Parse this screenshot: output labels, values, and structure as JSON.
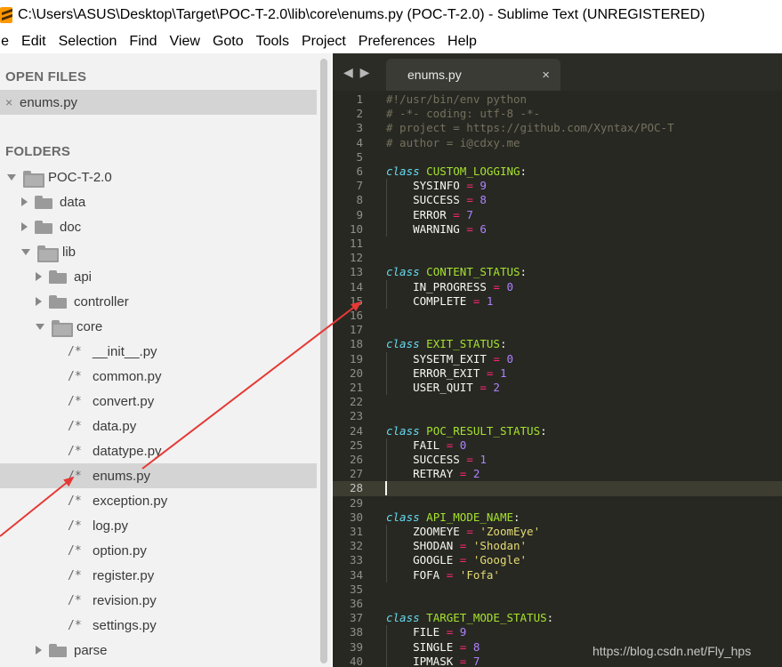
{
  "window": {
    "title": "C:\\Users\\ASUS\\Desktop\\Target\\POC-T-2.0\\lib\\core\\enums.py (POC-T-2.0) - Sublime Text (UNREGISTERED)"
  },
  "menu": [
    "ile",
    "Edit",
    "Selection",
    "Find",
    "View",
    "Goto",
    "Tools",
    "Project",
    "Preferences",
    "Help"
  ],
  "sidebar": {
    "open_files_heading": "OPEN FILES",
    "open_files": [
      {
        "label": "enums.py",
        "close": "×"
      }
    ],
    "folders_heading": "FOLDERS",
    "tree": [
      {
        "label": "POC-T-2.0",
        "kind": "folder",
        "expanded": true
      },
      {
        "label": "data",
        "kind": "folder",
        "expanded": false
      },
      {
        "label": "doc",
        "kind": "folder",
        "expanded": false
      },
      {
        "label": "lib",
        "kind": "folder",
        "expanded": true
      },
      {
        "label": "api",
        "kind": "folder",
        "expanded": false
      },
      {
        "label": "controller",
        "kind": "folder",
        "expanded": false
      },
      {
        "label": "core",
        "kind": "folder",
        "expanded": true
      },
      {
        "label": "__init__.py",
        "kind": "file"
      },
      {
        "label": "common.py",
        "kind": "file"
      },
      {
        "label": "convert.py",
        "kind": "file"
      },
      {
        "label": "data.py",
        "kind": "file"
      },
      {
        "label": "datatype.py",
        "kind": "file"
      },
      {
        "label": "enums.py",
        "kind": "file",
        "selected": true
      },
      {
        "label": "exception.py",
        "kind": "file"
      },
      {
        "label": "log.py",
        "kind": "file"
      },
      {
        "label": "option.py",
        "kind": "file"
      },
      {
        "label": "register.py",
        "kind": "file"
      },
      {
        "label": "revision.py",
        "kind": "file"
      },
      {
        "label": "settings.py",
        "kind": "file"
      },
      {
        "label": "parse",
        "kind": "folder",
        "expanded": false
      }
    ],
    "file_glyph": "/*"
  },
  "editor": {
    "tab_nav": "◀ ▶",
    "tab": {
      "label": "enums.py",
      "close": "×"
    },
    "current_line": 28,
    "lines": [
      {
        "n": "1",
        "t": [
          [
            "c-comment",
            "#!/usr/bin/env python"
          ]
        ]
      },
      {
        "n": "2",
        "t": [
          [
            "c-comment",
            "# -*- coding: utf-8 -*-"
          ]
        ]
      },
      {
        "n": "3",
        "t": [
          [
            "c-comment",
            "# project = https://github.com/Xyntax/POC-T"
          ]
        ]
      },
      {
        "n": "4",
        "t": [
          [
            "c-comment",
            "# author = i@cdxy.me"
          ]
        ]
      },
      {
        "n": "5",
        "t": []
      },
      {
        "n": "6",
        "t": [
          [
            "c-kw",
            "class"
          ],
          [
            "c-plain",
            " "
          ],
          [
            "c-cls",
            "CUSTOM_LOGGING"
          ],
          [
            "c-plain",
            ":"
          ]
        ]
      },
      {
        "n": "7",
        "t": [
          [
            "c-plain",
            "    SYSINFO "
          ],
          [
            "c-op",
            "="
          ],
          [
            "c-plain",
            " "
          ],
          [
            "c-num",
            "9"
          ]
        ]
      },
      {
        "n": "8",
        "t": [
          [
            "c-plain",
            "    SUCCESS "
          ],
          [
            "c-op",
            "="
          ],
          [
            "c-plain",
            " "
          ],
          [
            "c-num",
            "8"
          ]
        ]
      },
      {
        "n": "9",
        "t": [
          [
            "c-plain",
            "    ERROR "
          ],
          [
            "c-op",
            "="
          ],
          [
            "c-plain",
            " "
          ],
          [
            "c-num",
            "7"
          ]
        ]
      },
      {
        "n": "10",
        "t": [
          [
            "c-plain",
            "    WARNING "
          ],
          [
            "c-op",
            "="
          ],
          [
            "c-plain",
            " "
          ],
          [
            "c-num",
            "6"
          ]
        ]
      },
      {
        "n": "11",
        "t": []
      },
      {
        "n": "12",
        "t": []
      },
      {
        "n": "13",
        "t": [
          [
            "c-kw",
            "class"
          ],
          [
            "c-plain",
            " "
          ],
          [
            "c-cls",
            "CONTENT_STATUS"
          ],
          [
            "c-plain",
            ":"
          ]
        ]
      },
      {
        "n": "14",
        "t": [
          [
            "c-plain",
            "    IN_PROGRESS "
          ],
          [
            "c-op",
            "="
          ],
          [
            "c-plain",
            " "
          ],
          [
            "c-num",
            "0"
          ]
        ]
      },
      {
        "n": "15",
        "t": [
          [
            "c-plain",
            "    COMPLETE "
          ],
          [
            "c-op",
            "="
          ],
          [
            "c-plain",
            " "
          ],
          [
            "c-num",
            "1"
          ]
        ]
      },
      {
        "n": "16",
        "t": []
      },
      {
        "n": "17",
        "t": []
      },
      {
        "n": "18",
        "t": [
          [
            "c-kw",
            "class"
          ],
          [
            "c-plain",
            " "
          ],
          [
            "c-cls",
            "EXIT_STATUS"
          ],
          [
            "c-plain",
            ":"
          ]
        ]
      },
      {
        "n": "19",
        "t": [
          [
            "c-plain",
            "    SYSETM_EXIT "
          ],
          [
            "c-op",
            "="
          ],
          [
            "c-plain",
            " "
          ],
          [
            "c-num",
            "0"
          ]
        ]
      },
      {
        "n": "20",
        "t": [
          [
            "c-plain",
            "    ERROR_EXIT "
          ],
          [
            "c-op",
            "="
          ],
          [
            "c-plain",
            " "
          ],
          [
            "c-num",
            "1"
          ]
        ]
      },
      {
        "n": "21",
        "t": [
          [
            "c-plain",
            "    USER_QUIT "
          ],
          [
            "c-op",
            "="
          ],
          [
            "c-plain",
            " "
          ],
          [
            "c-num",
            "2"
          ]
        ]
      },
      {
        "n": "22",
        "t": []
      },
      {
        "n": "23",
        "t": []
      },
      {
        "n": "24",
        "t": [
          [
            "c-kw",
            "class"
          ],
          [
            "c-plain",
            " "
          ],
          [
            "c-cls",
            "POC_RESULT_STATUS"
          ],
          [
            "c-plain",
            ":"
          ]
        ]
      },
      {
        "n": "25",
        "t": [
          [
            "c-plain",
            "    FAIL "
          ],
          [
            "c-op",
            "="
          ],
          [
            "c-plain",
            " "
          ],
          [
            "c-num",
            "0"
          ]
        ]
      },
      {
        "n": "26",
        "t": [
          [
            "c-plain",
            "    SUCCESS "
          ],
          [
            "c-op",
            "="
          ],
          [
            "c-plain",
            " "
          ],
          [
            "c-num",
            "1"
          ]
        ]
      },
      {
        "n": "27",
        "t": [
          [
            "c-plain",
            "    RETRAY "
          ],
          [
            "c-op",
            "="
          ],
          [
            "c-plain",
            " "
          ],
          [
            "c-num",
            "2"
          ]
        ]
      },
      {
        "n": "28",
        "t": []
      },
      {
        "n": "29",
        "t": []
      },
      {
        "n": "30",
        "t": [
          [
            "c-kw",
            "class"
          ],
          [
            "c-plain",
            " "
          ],
          [
            "c-cls",
            "API_MODE_NAME"
          ],
          [
            "c-plain",
            ":"
          ]
        ]
      },
      {
        "n": "31",
        "t": [
          [
            "c-plain",
            "    ZOOMEYE "
          ],
          [
            "c-op",
            "="
          ],
          [
            "c-plain",
            " "
          ],
          [
            "c-str",
            "'ZoomEye'"
          ]
        ]
      },
      {
        "n": "32",
        "t": [
          [
            "c-plain",
            "    SHODAN "
          ],
          [
            "c-op",
            "="
          ],
          [
            "c-plain",
            " "
          ],
          [
            "c-str",
            "'Shodan'"
          ]
        ]
      },
      {
        "n": "33",
        "t": [
          [
            "c-plain",
            "    GOOGLE "
          ],
          [
            "c-op",
            "="
          ],
          [
            "c-plain",
            " "
          ],
          [
            "c-str",
            "'Google'"
          ]
        ]
      },
      {
        "n": "34",
        "t": [
          [
            "c-plain",
            "    FOFA "
          ],
          [
            "c-op",
            "="
          ],
          [
            "c-plain",
            " "
          ],
          [
            "c-str",
            "'Fofa'"
          ]
        ]
      },
      {
        "n": "35",
        "t": []
      },
      {
        "n": "36",
        "t": []
      },
      {
        "n": "37",
        "t": [
          [
            "c-kw",
            "class"
          ],
          [
            "c-plain",
            " "
          ],
          [
            "c-cls",
            "TARGET_MODE_STATUS"
          ],
          [
            "c-plain",
            ":"
          ]
        ]
      },
      {
        "n": "38",
        "t": [
          [
            "c-plain",
            "    FILE "
          ],
          [
            "c-op",
            "="
          ],
          [
            "c-plain",
            " "
          ],
          [
            "c-num",
            "9"
          ]
        ]
      },
      {
        "n": "39",
        "t": [
          [
            "c-plain",
            "    SINGLE "
          ],
          [
            "c-op",
            "="
          ],
          [
            "c-plain",
            " "
          ],
          [
            "c-num",
            "8"
          ]
        ]
      },
      {
        "n": "40",
        "t": [
          [
            "c-plain",
            "    IPMASK "
          ],
          [
            "c-op",
            "="
          ],
          [
            "c-plain",
            " "
          ],
          [
            "c-num",
            "7"
          ]
        ]
      }
    ],
    "watermark": "https://blog.csdn.net/Fly_hps"
  },
  "colors": {
    "editor_bg": "#272822",
    "sidebar_bg": "#f2f2f2",
    "annotation_arrow": "#e53935"
  }
}
